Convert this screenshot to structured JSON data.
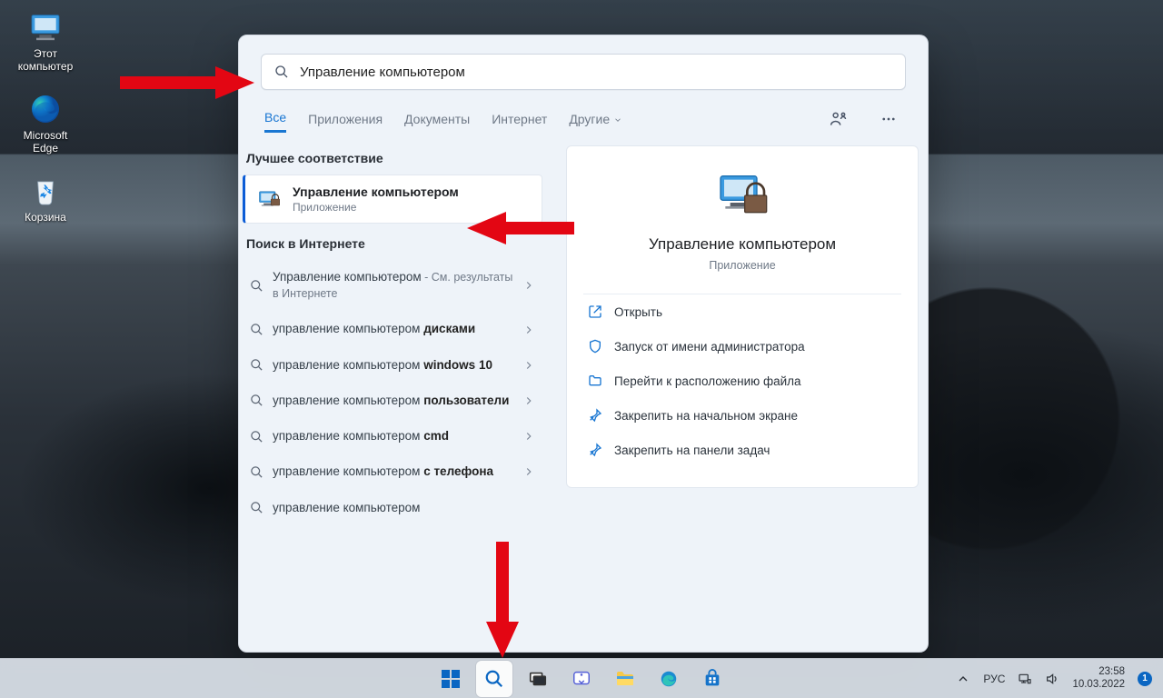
{
  "desktop": {
    "icons": [
      {
        "label": "Этот компьютер"
      },
      {
        "label": "Microsoft Edge"
      },
      {
        "label": "Корзина"
      }
    ]
  },
  "search": {
    "query": "Управление компьютером",
    "tabs": {
      "all": "Все",
      "apps": "Приложения",
      "docs": "Документы",
      "web": "Интернет",
      "more": "Другие"
    },
    "best_header": "Лучшее соответствие",
    "best": {
      "title": "Управление компьютером",
      "subtitle": "Приложение"
    },
    "web_header": "Поиск в Интернете",
    "web_results": [
      {
        "prefix": "Управление компьютером",
        "suffix": " - См. результаты в Интернете",
        "bold": ""
      },
      {
        "prefix": "управление компьютером ",
        "bold": "дисками",
        "suffix": ""
      },
      {
        "prefix": "управление компьютером ",
        "bold": "windows 10",
        "suffix": ""
      },
      {
        "prefix": "управление компьютером ",
        "bold": "пользователи",
        "suffix": ""
      },
      {
        "prefix": "управление компьютером ",
        "bold": "cmd",
        "suffix": ""
      },
      {
        "prefix": "управление компьютером ",
        "bold": "с телефона",
        "suffix": ""
      },
      {
        "prefix": "управление компьютером",
        "bold": "",
        "suffix": ""
      }
    ],
    "detail": {
      "title": "Управление компьютером",
      "subtitle": "Приложение",
      "actions": {
        "open": "Открыть",
        "admin": "Запуск от имени администратора",
        "location": "Перейти к расположению файла",
        "pin_start": "Закрепить на начальном экране",
        "pin_task": "Закрепить на панели задач"
      }
    }
  },
  "taskbar": {
    "lang": "РУС",
    "time": "23:58",
    "date": "10.03.2022",
    "notif_count": "1"
  }
}
